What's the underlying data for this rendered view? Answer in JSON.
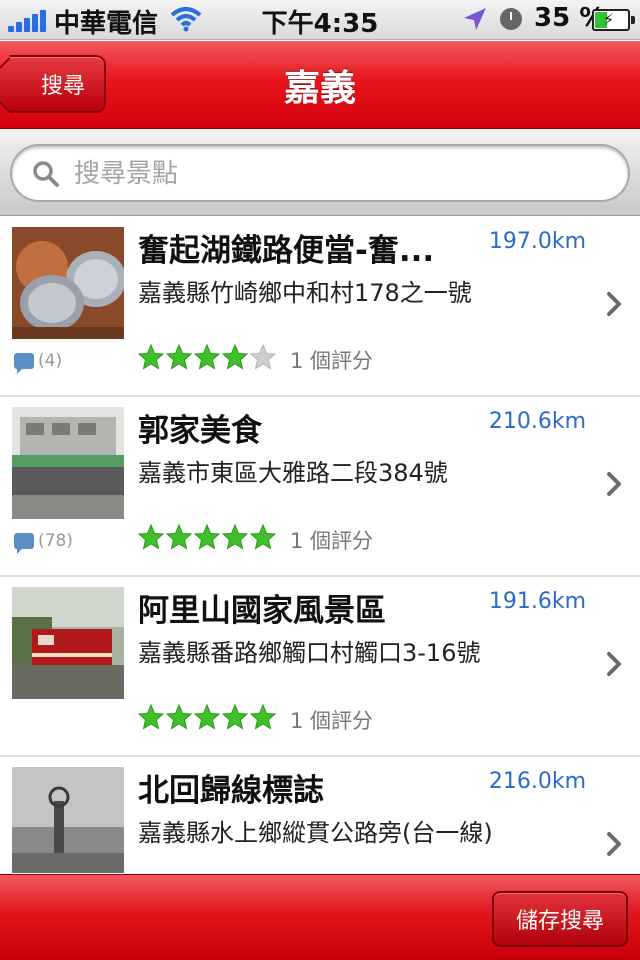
{
  "status_bar": {
    "carrier": "中華電信",
    "time": "下午4:35",
    "battery": "35 %",
    "battery_level": 0.35,
    "icons": [
      "signal-icon",
      "wifi-icon",
      "location-icon",
      "clock-icon",
      "battery-icon"
    ]
  },
  "nav": {
    "back_label": "搜尋",
    "title": "嘉義"
  },
  "search": {
    "placeholder": "搜尋景點"
  },
  "places": [
    {
      "name": "奮起湖鐵路便當-奮...",
      "distance": "197.0km",
      "address": "嘉義縣竹崎鄉中和村178之一號",
      "comments": "(4)",
      "stars": 4,
      "rating_text": "1 個評分"
    },
    {
      "name": "郭家美食",
      "distance": "210.6km",
      "address": "嘉義市東區大雅路二段384號",
      "comments": "(78)",
      "stars": 5,
      "rating_text": "1 個評分"
    },
    {
      "name": "阿里山國家風景區",
      "distance": "191.6km",
      "address": "嘉義縣番路鄉觸口村觸口3-16號",
      "comments": "",
      "stars": 5,
      "rating_text": "1 個評分"
    },
    {
      "name": "北回歸線標誌",
      "distance": "216.0km",
      "address": "嘉義縣水上鄉縱貫公路旁(台一線)",
      "comments": "",
      "stars": null,
      "rating_text": ""
    }
  ],
  "toolbar": {
    "save_label": "儲存搜尋"
  },
  "colors": {
    "accent_red": "#e8141d",
    "distance_blue": "#2a6cc7",
    "star_green": "#3fbf2a"
  }
}
